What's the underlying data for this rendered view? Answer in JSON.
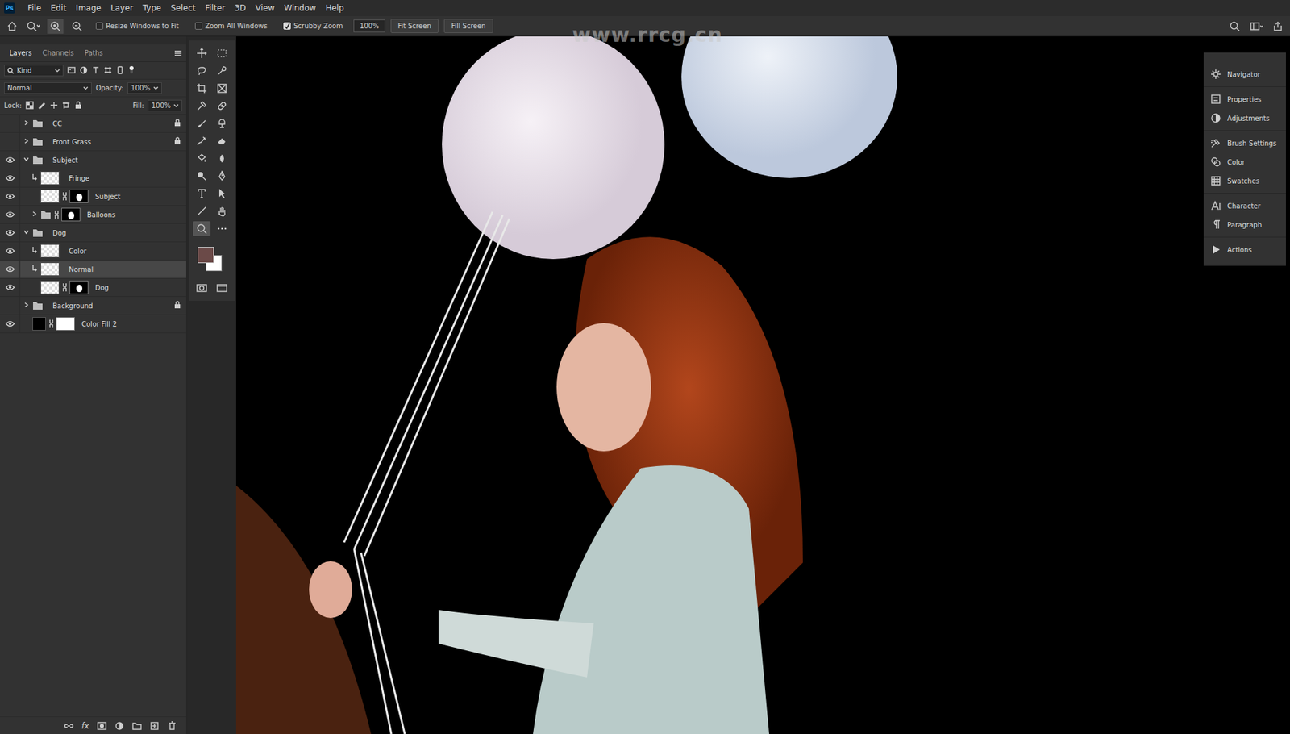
{
  "app": {
    "logo": "Ps"
  },
  "menu": [
    "File",
    "Edit",
    "Image",
    "Layer",
    "Type",
    "Select",
    "Filter",
    "3D",
    "View",
    "Window",
    "Help"
  ],
  "options_bar": {
    "checkboxes": [
      {
        "label": "Resize Windows to Fit",
        "checked": false
      },
      {
        "label": "Zoom All Windows",
        "checked": false
      },
      {
        "label": "Scrubby Zoom",
        "checked": true
      }
    ],
    "zoom": "100%",
    "buttons": [
      "Fit Screen",
      "Fill Screen"
    ]
  },
  "watermark": "www.rrcg.cn",
  "layers_panel": {
    "tabs": [
      {
        "label": "Layers",
        "selected": true
      },
      {
        "label": "Channels",
        "selected": false
      },
      {
        "label": "Paths",
        "selected": false
      }
    ],
    "filter": "Kind",
    "blend_mode": "Normal",
    "opacity_label": "Opacity:",
    "opacity": "100%",
    "lock_label": "Lock:",
    "fill_label": "Fill:",
    "fill": "100%",
    "footer_fx": "fx",
    "layers": [
      {
        "name": "CC",
        "kind": "group",
        "depth": 0,
        "visible": false,
        "expanded": false,
        "locked": true,
        "mask": false,
        "selected": false
      },
      {
        "name": "Front Grass",
        "kind": "group",
        "depth": 0,
        "visible": false,
        "expanded": false,
        "locked": true,
        "mask": false,
        "selected": false
      },
      {
        "name": "Subject",
        "kind": "group",
        "depth": 0,
        "visible": true,
        "expanded": true,
        "locked": false,
        "mask": false,
        "selected": false
      },
      {
        "name": "Fringe",
        "kind": "layer",
        "depth": 1,
        "visible": true,
        "clipped": true,
        "locked": false,
        "mask": false,
        "selected": false
      },
      {
        "name": "Subject",
        "kind": "layer",
        "depth": 1,
        "visible": true,
        "clipped": false,
        "locked": false,
        "mask": true,
        "selected": false
      },
      {
        "name": "Balloons",
        "kind": "group",
        "depth": 1,
        "visible": true,
        "expanded": false,
        "locked": false,
        "mask": true,
        "selected": false
      },
      {
        "name": "Dog",
        "kind": "group",
        "depth": 0,
        "visible": true,
        "expanded": true,
        "locked": false,
        "mask": false,
        "selected": false
      },
      {
        "name": "Color",
        "kind": "layer",
        "depth": 1,
        "visible": true,
        "clipped": true,
        "locked": false,
        "mask": false,
        "selected": false
      },
      {
        "name": "Normal",
        "kind": "layer",
        "depth": 1,
        "visible": true,
        "clipped": true,
        "locked": false,
        "mask": false,
        "selected": true
      },
      {
        "name": "Dog",
        "kind": "layer",
        "depth": 1,
        "visible": true,
        "clipped": false,
        "locked": false,
        "mask": true,
        "selected": false
      },
      {
        "name": "Background",
        "kind": "group",
        "depth": 0,
        "visible": false,
        "expanded": false,
        "locked": true,
        "mask": false,
        "selected": false
      },
      {
        "name": "Color Fill 2",
        "kind": "fill",
        "depth": 0,
        "visible": true,
        "clipped": false,
        "locked": false,
        "mask": true,
        "selected": false
      }
    ]
  },
  "tools": {
    "items": [
      {
        "selected": false
      },
      {
        "selected": false
      },
      {
        "selected": false
      },
      {
        "selected": false
      },
      {
        "selected": false
      },
      {
        "selected": false
      },
      {
        "selected": false
      },
      {
        "selected": false
      },
      {
        "selected": false
      },
      {
        "selected": false
      },
      {
        "selected": false
      },
      {
        "selected": false
      },
      {
        "selected": false
      },
      {
        "selected": false
      },
      {
        "selected": false
      },
      {
        "selected": false
      },
      {
        "selected": false
      },
      {
        "selected": false
      },
      {
        "selected": false
      },
      {
        "selected": false
      },
      {
        "selected": true
      },
      {
        "selected": false
      }
    ],
    "foreground": "#6b4a48",
    "background": "#ffffff"
  },
  "right_panel": {
    "groups": [
      [
        {
          "label": "Navigator"
        }
      ],
      [
        {
          "label": "Properties"
        },
        {
          "label": "Adjustments"
        }
      ],
      [
        {
          "label": "Brush Settings"
        },
        {
          "label": "Color"
        },
        {
          "label": "Swatches"
        }
      ],
      [
        {
          "label": "Character"
        },
        {
          "label": "Paragraph"
        }
      ],
      [
        {
          "label": "Actions"
        }
      ]
    ]
  }
}
